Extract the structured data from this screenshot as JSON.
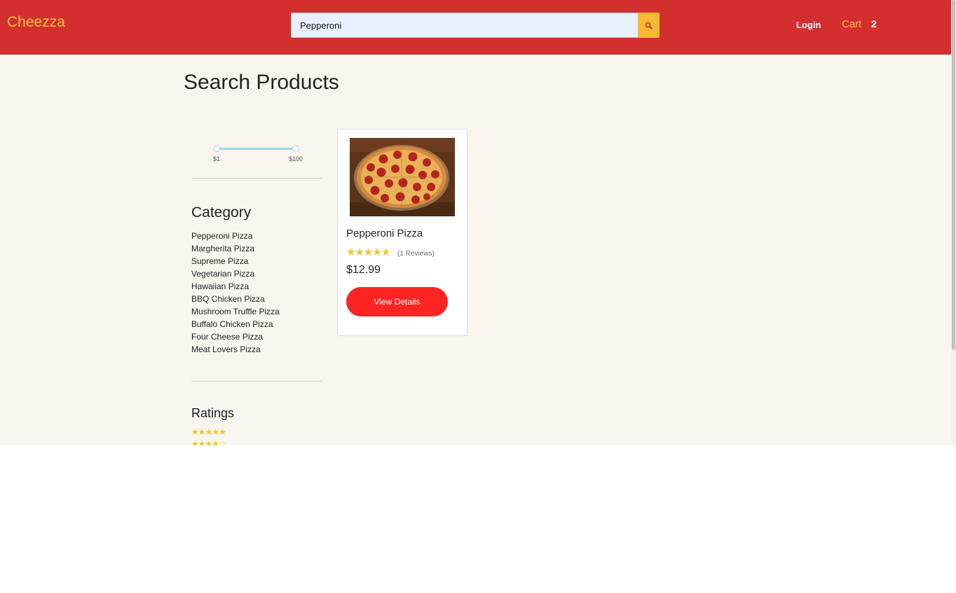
{
  "header": {
    "brand": "Cheezza",
    "search": {
      "value": "Pepperoni",
      "placeholder": ""
    },
    "search_button_icon": "search-icon",
    "login_label": "Login",
    "cart_label": "Cart",
    "cart_count": "2"
  },
  "page": {
    "title": "Search Products"
  },
  "filters": {
    "price": {
      "min_label": "$1",
      "max_label": "$100",
      "min": 1,
      "max": 100
    },
    "category_title": "Category",
    "categories": [
      "Pepperoni Pizza",
      "Margherita Pizza",
      "Supreme Pizza",
      "Vegetarian Pizza",
      "Hawaiian Pizza",
      "BBQ Chicken Pizza",
      "Mushroom Truffle Pizza",
      "Buffalo Chicken Pizza",
      "Four Cheese Pizza",
      "Meat Lovers Pizza"
    ],
    "ratings_title": "Ratings",
    "rating_options": [
      5,
      4
    ]
  },
  "products": [
    {
      "name": "Pepperoni Pizza",
      "rating": 5,
      "reviews": "(1 Reviews)",
      "price": "$12.99",
      "button_label": "View Details"
    }
  ],
  "colors": {
    "header_bg": "#d32f2f",
    "brand": "#ffc24a",
    "accent_button": "#fe2424",
    "search_button": "#f7b933",
    "star": "#f5c518",
    "page_bg": "#f8f5ee"
  }
}
